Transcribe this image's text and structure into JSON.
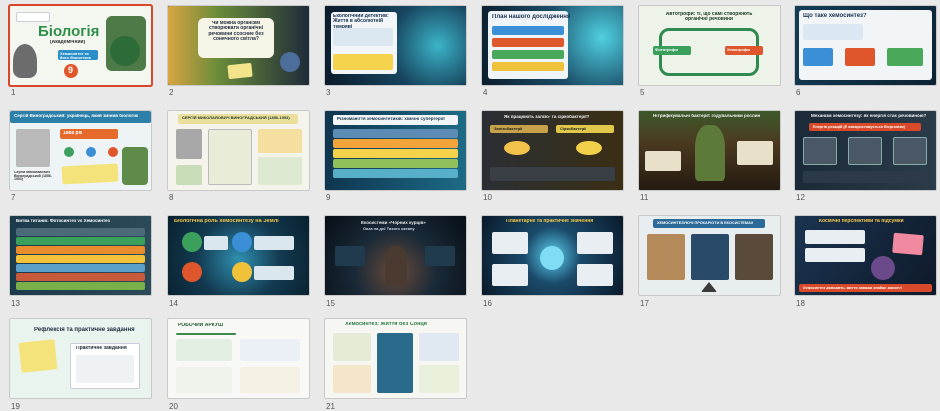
{
  "view": "slide-sorter",
  "slides": [
    {
      "n": "1",
      "title": "Біологія",
      "subtitle": "(Академічний)",
      "badge": "9",
      "small": "Хемосинтез та його біологічна роль"
    },
    {
      "n": "2",
      "title": "Чи можна організмі створювати органічні речовини ссосние без сонячного світла?"
    },
    {
      "n": "3",
      "title": "Екологічний детектив: Життя в абсолютній темряві"
    },
    {
      "n": "4",
      "title": "План нашого дослідження"
    },
    {
      "n": "5",
      "title": "Автотрофи: ті, що самі створюють органічні речовини",
      "left": "Фототрофи",
      "right": "Хемотрофи"
    },
    {
      "n": "6",
      "title": "Що таке хемосинтез?"
    },
    {
      "n": "7",
      "title": "Сергій Виноградський: українець, який змінив біологію",
      "year": "1888 рік",
      "caption": "Сергій Миколайович Виноградський (1856-1953)"
    },
    {
      "n": "8",
      "title": "СЕРГІЙ МИКОЛАЙОВИЧ ВИНОГРАДСЬКИЙ (1856-1953)"
    },
    {
      "n": "9",
      "title": "Різноманіття хемосинтетиків: хімічні супергерої"
    },
    {
      "n": "10",
      "title": "Як працюють залізо- та сіркобактерії?",
      "left": "Залізобактерії",
      "right": "Сіркобактерії"
    },
    {
      "n": "11",
      "title": "Нітрифікувальні бактерії: годувальники рослин"
    },
    {
      "n": "12",
      "title": "Механізм хемосинтезу: як енергія стає речовиною?",
      "sub": "Енергія реакцій (Е використовується біорганізм)"
    },
    {
      "n": "13",
      "title": "Битва титанів: Фотосинтез vs Хемосинтез"
    },
    {
      "n": "14",
      "title": "Біологічна роль хемосинтезу на Землі"
    },
    {
      "n": "15",
      "title": "Екосистеми «Чорних курців»",
      "sub": "Оаза на дні Тихого океану"
    },
    {
      "n": "16",
      "title": "Планетарне та практичне значення"
    },
    {
      "n": "17",
      "title": "ХЕМОСИНТЕЗУЮЧІ ПРОКАРІОТИ В ЕКОСИСТЕМАХ"
    },
    {
      "n": "18",
      "title": "Космічні перспективи та підсумки",
      "sub": "Хемосинтез доводить, життя завжди знайде дорогу!"
    },
    {
      "n": "19",
      "title": "Рефлексія та практичне завдання",
      "card": "Практичне завдання"
    },
    {
      "n": "20",
      "title": "РОБОЧИЙ АРКУШ"
    },
    {
      "n": "21",
      "title": "Хемосинтез: Життя без Сонця"
    }
  ],
  "colors": {
    "selection": "#d9472b",
    "background": "#e9e9e9"
  }
}
